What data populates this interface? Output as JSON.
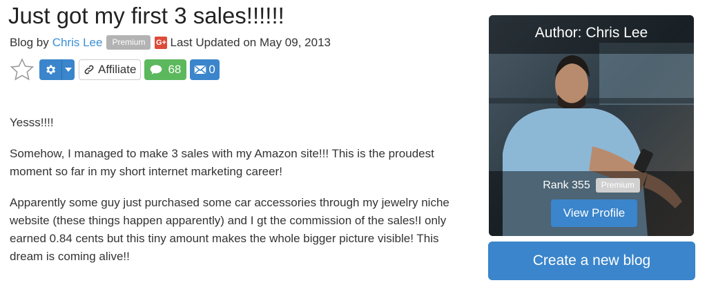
{
  "post": {
    "title": "Just got my first 3 sales!!!!!!",
    "meta": {
      "blog_by": "Blog by",
      "author": "Chris Lee",
      "premium_badge": "Premium",
      "gplus_glyph": "G+",
      "updated": "Last Updated on May 09, 2013"
    },
    "toolbar": {
      "affiliate_label": "Affiliate",
      "comments_count": "68",
      "messages_count": "0"
    },
    "paragraphs": [
      "Yesss!!!!",
      "Somehow, I managed to make 3 sales with my Amazon site!!! This is the proudest moment so far in my short internet marketing career!",
      "Apparently some guy just purchased some car accessories through my jewelry niche website (these things happen apparently) and I gt the commission of the sales!I only earned 0.84 cents but this tiny amount makes the whole bigger picture visible! This dream is coming alive!!"
    ]
  },
  "author_card": {
    "title": "Author: Chris Lee",
    "rank": "Rank 355",
    "badge": "Premium",
    "view_profile_label": "View Profile"
  },
  "create_blog_label": "Create a new blog",
  "colors": {
    "primary": "#3a85cb",
    "success": "#5cb85c",
    "badge_gray": "#b3b3b3",
    "gplus_red": "#dd4b39",
    "link": "#3a8fd6"
  },
  "icons": [
    "star-outline-icon",
    "gear-icon",
    "caret-down-icon",
    "link-icon",
    "comment-icon",
    "envelope-icon",
    "google-plus-icon"
  ]
}
